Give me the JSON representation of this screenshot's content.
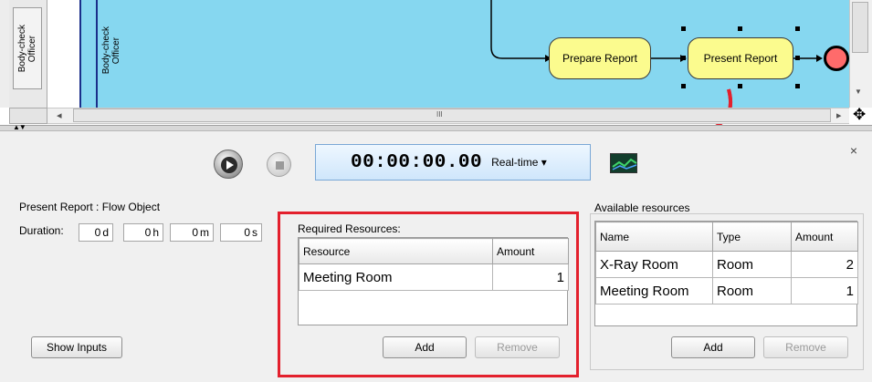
{
  "diagram": {
    "pool_label": "Body-check\nOfficer",
    "lane_label": "Body-check\nOfficer",
    "tasks": [
      {
        "label": "Prepare Report"
      },
      {
        "label": "Present Report"
      }
    ],
    "hscroll_mid_glyph": "III",
    "hscroll_left": "◂",
    "hscroll_right": "▸",
    "move_icon": "✥",
    "collapse_arrows": "▲▼"
  },
  "simulation": {
    "time": "00:00:00.00",
    "mode": "Real-time ▾",
    "close_glyph": "×"
  },
  "flow_object": {
    "title": "Present Report : Flow Object",
    "duration_label": "Duration:",
    "duration": [
      {
        "value": "0",
        "unit": "d"
      },
      {
        "value": "0",
        "unit": "h"
      },
      {
        "value": "0",
        "unit": "m"
      },
      {
        "value": "0",
        "unit": "s"
      }
    ],
    "show_inputs_label": "Show Inputs"
  },
  "required": {
    "title": "Required Resources:",
    "columns": [
      "Resource",
      "Amount"
    ],
    "rows": [
      {
        "name": "Meeting Room",
        "amount": "1"
      }
    ],
    "add_label": "Add",
    "remove_label": "Remove"
  },
  "available": {
    "title": "Available resources",
    "columns": [
      "Name",
      "Type",
      "Amount"
    ],
    "rows": [
      {
        "name": "X-Ray Room",
        "type": "Room",
        "amount": "2"
      },
      {
        "name": "Meeting Room",
        "type": "Room",
        "amount": "1"
      }
    ],
    "add_label": "Add",
    "remove_label": "Remove"
  },
  "colors": {
    "lane": "#86d7f0",
    "task": "#fbfb8e",
    "end_event": "#ff6b6b",
    "highlight": "#e3202d"
  }
}
